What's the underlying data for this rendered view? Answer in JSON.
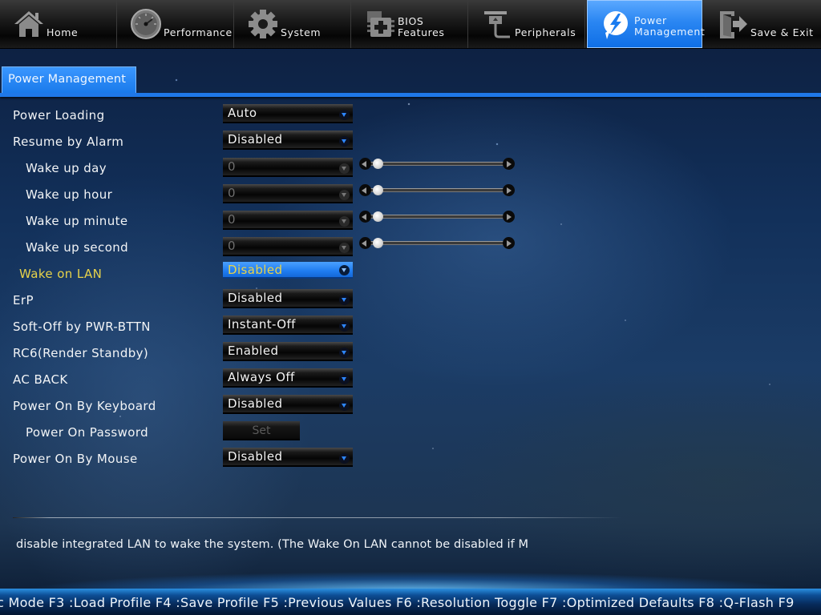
{
  "nav": {
    "items": [
      {
        "label": "Home",
        "icon": "home-icon",
        "active": false
      },
      {
        "label": "Performance",
        "icon": "speedometer-icon",
        "active": false
      },
      {
        "label": "System",
        "icon": "gear-icon",
        "active": false
      },
      {
        "label": "BIOS\nFeatures",
        "icon": "chip-icon",
        "active": false
      },
      {
        "label": "Peripherals",
        "icon": "peripheral-icon",
        "active": false
      },
      {
        "label": "Power\nManagement",
        "icon": "power-bolt-icon",
        "active": true
      },
      {
        "label": "Save & Exit",
        "icon": "exit-door-icon",
        "active": false
      }
    ]
  },
  "tab": {
    "label": "Power Management"
  },
  "settings": [
    {
      "label": "Power Loading",
      "value": "Auto",
      "type": "select"
    },
    {
      "label": "Resume by Alarm",
      "value": "Disabled",
      "type": "select"
    },
    {
      "label": "Wake up day",
      "value": "0",
      "type": "slider",
      "disabled": true,
      "slider_fraction": 0.0
    },
    {
      "label": "Wake up hour",
      "value": "0",
      "type": "slider",
      "disabled": true,
      "slider_fraction": 0.0
    },
    {
      "label": "Wake up minute",
      "value": "0",
      "type": "slider",
      "disabled": true,
      "slider_fraction": 0.0
    },
    {
      "label": "Wake up second",
      "value": "0",
      "type": "slider",
      "disabled": true,
      "slider_fraction": 0.0
    },
    {
      "label": "Wake on LAN",
      "value": "Disabled",
      "type": "select",
      "focused": true
    },
    {
      "label": "ErP",
      "value": "Disabled",
      "type": "select"
    },
    {
      "label": "Soft-Off by PWR-BTTN",
      "value": "Instant-Off",
      "type": "select"
    },
    {
      "label": "RC6(Render Standby)",
      "value": "Enabled",
      "type": "select"
    },
    {
      "label": "AC BACK",
      "value": "Always Off",
      "type": "select"
    },
    {
      "label": "Power On By Keyboard",
      "value": "Disabled",
      "type": "select"
    },
    {
      "label": "Power On Password",
      "value": "Set",
      "type": "button",
      "disabled": true
    },
    {
      "label": "Power On By Mouse",
      "value": "Disabled",
      "type": "select"
    }
  ],
  "help_text": "disable integrated LAN to wake the system. (The Wake On LAN cannot be disabled if M",
  "footer": {
    "keys": "c Mode F3 :Load Profile F4 :Save Profile F5 :Previous Values F6 :Resolution Toggle F7 :Optimized Defaults F8 :Q-Flash F9"
  },
  "colors": {
    "accent": "#1f78e8",
    "highlight_label": "#e8d34a",
    "footer_bg": "#072a5a"
  }
}
